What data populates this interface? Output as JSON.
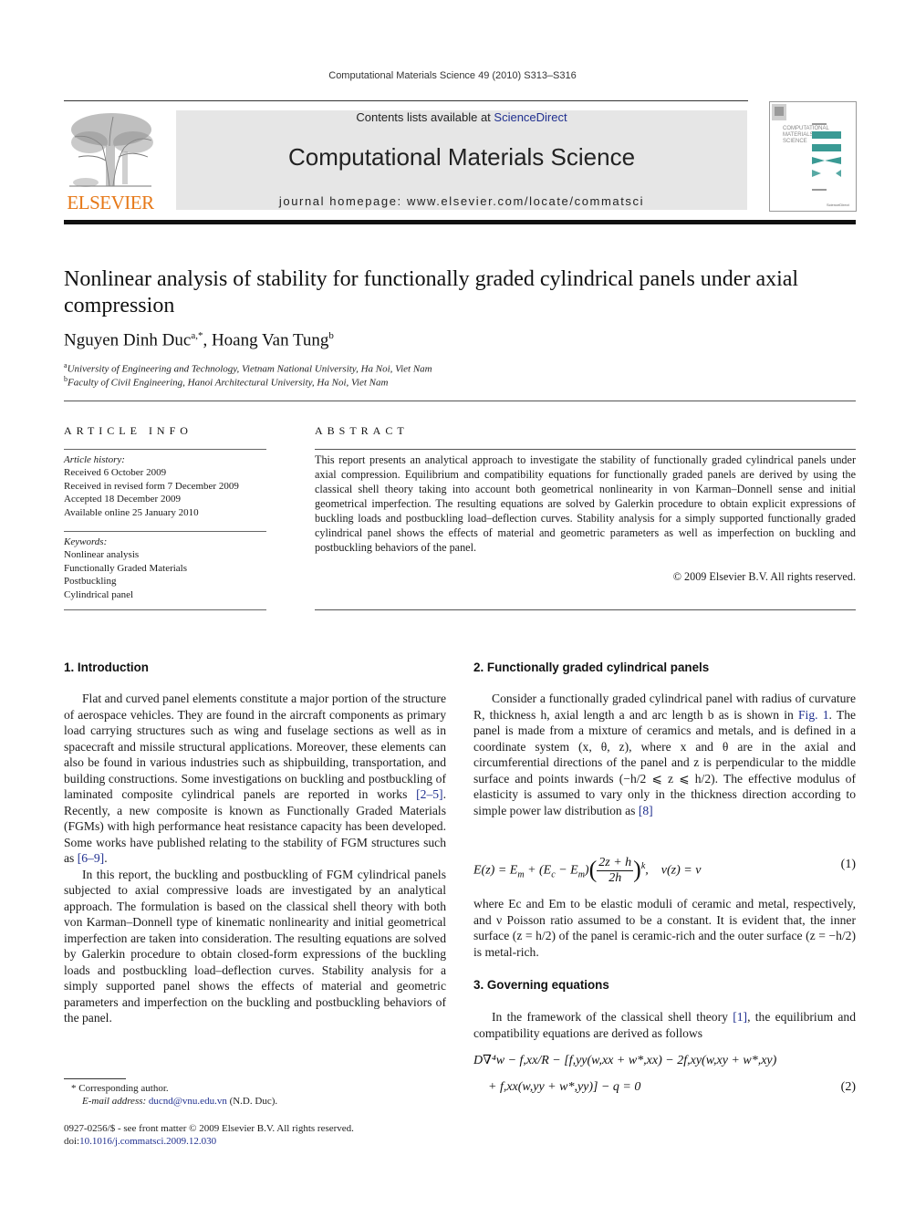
{
  "header": {
    "running_head": "Computational Materials Science 49 (2010) S313–S316",
    "contents_prefix": "Contents lists available at ",
    "contents_link": "ScienceDirect",
    "journal_title": "Computational Materials Science",
    "homepage": "journal homepage: www.elsevier.com/locate/commatsci",
    "publisher_logo_text": "ELSEVIER",
    "cover_lines": [
      "COMPUTATIONAL",
      "MATERIALS",
      "SCIENCE"
    ],
    "colors": {
      "elsevier_orange": "#e67817",
      "link_blue": "#1f2f8f",
      "banner_gray": "#e6e6e6",
      "cover_teal": "#3a9a94"
    }
  },
  "article": {
    "title": "Nonlinear analysis of stability for functionally graded cylindrical panels under axial compression",
    "authors": [
      {
        "name": "Nguyen Dinh Duc",
        "marks": "a,*"
      },
      {
        "name": "Hoang Van Tung",
        "marks": "b"
      }
    ],
    "author_separator": ", ",
    "affiliations": [
      {
        "mark": "a",
        "text": "University of Engineering and Technology, Vietnam National University, Ha Noi, Viet Nam"
      },
      {
        "mark": "b",
        "text": "Faculty of Civil Engineering, Hanoi Architectural University, Ha Noi, Viet Nam"
      }
    ]
  },
  "article_info": {
    "heading": "ARTICLE INFO",
    "history_label": "Article history:",
    "history": [
      "Received 6 October 2009",
      "Received in revised form 7 December 2009",
      "Accepted 18 December 2009",
      "Available online 25 January 2010"
    ],
    "keywords_label": "Keywords:",
    "keywords": [
      "Nonlinear analysis",
      "Functionally Graded Materials",
      "Postbuckling",
      "Cylindrical panel"
    ]
  },
  "abstract": {
    "heading": "ABSTRACT",
    "text": "This report presents an analytical approach to investigate the stability of functionally graded cylindrical panels under axial compression. Equilibrium and compatibility equations for functionally graded panels are derived by using the classical shell theory taking into account both geometrical nonlinearity in von Karman–Donnell sense and initial geometrical imperfection. The resulting equations are solved by Galerkin procedure to obtain explicit expressions of buckling loads and postbuckling load–deflection curves. Stability analysis for a simply supported functionally graded cylindrical panel shows the effects of material and geometric parameters as well as imperfection on buckling and postbuckling behaviors of the panel.",
    "copyright": "© 2009 Elsevier B.V. All rights reserved."
  },
  "sections": {
    "intro": {
      "heading": "1. Introduction",
      "p1_a": "Flat and curved panel elements constitute a major portion of the structure of aerospace vehicles. They are found in the aircraft components as primary load carrying structures such as wing and fuselage sections as well as in spacecraft and missile structural applications. Moreover, these elements can also be found in various industries such as shipbuilding, transportation, and building constructions. Some investigations on buckling and postbuckling of laminated composite cylindrical panels are reported in works ",
      "p1_ref1": "[2–5]",
      "p1_b": ". Recently, a new composite is known as Functionally Graded Materials (FGMs) with high performance heat resistance capacity has been developed. Some works have published relating to the stability of FGM structures such as ",
      "p1_ref2": "[6–9]",
      "p1_c": ".",
      "p2": "In this report, the buckling and postbuckling of FGM cylindrical panels subjected to axial compressive loads are investigated by an analytical approach. The formulation is based on the classical shell theory with both von Karman–Donnell type of kinematic nonlinearity and initial geometrical imperfection are taken into consideration. The resulting equations are solved by Galerkin procedure to obtain closed-form expressions of the buckling loads and postbuckling load–deflection curves. Stability analysis for a simply supported panel shows the effects of material and geometric parameters and imperfection on the buckling and postbuckling behaviors of the panel."
    },
    "fg_panels": {
      "heading": "2. Functionally graded cylindrical panels",
      "p1_a": "Consider a functionally graded cylindrical panel with radius of curvature R, thickness h, axial length a and arc length b as is shown in ",
      "p1_fig": "Fig. 1",
      "p1_b": ". The panel is made from a mixture of ceramics and metals, and is defined in a coordinate system (x, θ, z), where x and θ are in the axial and circumferential directions of the panel and z is perpendicular to the middle surface and points inwards (−h/2 ⩽ z ⩽ h/2). The effective modulus of elasticity is assumed to vary only in the thickness direction according to simple power law distribution as ",
      "p1_ref": "[8]",
      "eq1_lhs": "E(z) = E",
      "eq1_text": "E(z) = Em + (Ec − Em)((2z + h)/2h)^k,   ν(z) = ν",
      "eq1_number": "(1)",
      "p2": "where Ec and Em to be elastic moduli of ceramic and metal, respectively, and ν Poisson ratio assumed to be a constant. It is evident that, the inner surface (z = h/2) of the panel is ceramic-rich and the outer surface (z = −h/2) is metal-rich."
    },
    "governing": {
      "heading": "3. Governing equations",
      "p1_a": "In the framework of the classical shell theory ",
      "p1_ref": "[1]",
      "p1_b": ", the equilibrium and compatibility equations are derived as follows",
      "eq2_line1": "D∇⁴w − f,xx/R − [f,yy(w,xx + w*,xx) − 2f,xy(w,xy + w*,xy)",
      "eq2_line2": "+ f,xx(w,yy + w*,yy)] − q = 0",
      "eq2_number": "(2)"
    }
  },
  "footnotes": {
    "corresponding": "* Corresponding author.",
    "email_label": "E-mail address: ",
    "email": "ducnd@vnu.edu.vn",
    "email_suffix": " (N.D. Duc).",
    "issn_line": "0927-0256/$ - see front matter © 2009 Elsevier B.V. All rights reserved.",
    "doi_label": "doi:",
    "doi": "10.1016/j.commatsci.2009.12.030"
  }
}
